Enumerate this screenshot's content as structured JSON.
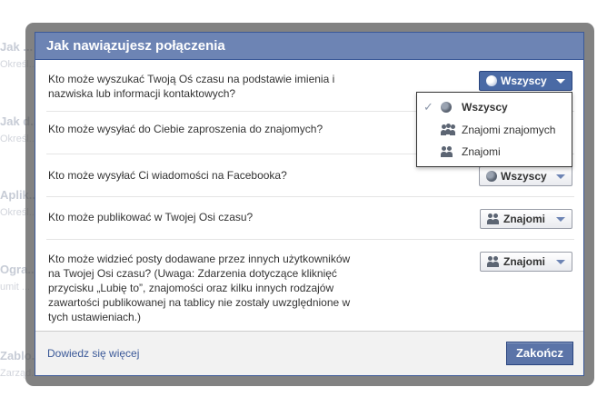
{
  "background": {
    "items": [
      {
        "title": "Jak ...",
        "sub": "Określ..."
      },
      {
        "title": "Jak d...",
        "sub": "Określ..."
      },
      {
        "title": "Aplik...",
        "sub": "Określ..."
      },
      {
        "title": "Ogra...",
        "sub": "umit ..."
      },
      {
        "title": "Zablo...",
        "sub": "Zarząd..."
      }
    ]
  },
  "dialog": {
    "title": "Jak nawiązujesz połączenia",
    "rows": [
      {
        "question": "Kto może wyszukać Twoją Oś czasu na podstawie imienia i\nnazwiska lub informacji kontaktowych?",
        "value": "Wszyscy",
        "icon": "globe-icon",
        "open": true
      },
      {
        "question": "Kto może wysyłać do Ciebie zaproszenia do znajomych?",
        "value": "",
        "icon": "",
        "open": false
      },
      {
        "question": "Kto może wysyłać Ci wiadomości na Facebooka?",
        "value": "Wszyscy",
        "icon": "globe-icon",
        "open": false
      },
      {
        "question": "Kto może publikować w Twojej Osi czasu?",
        "value": "Znajomi",
        "icon": "friends-icon",
        "open": false
      },
      {
        "question": "Kto może widzieć posty dodawane przez innych użytkowników\nna Twojej Osi czasu? (Uwaga: Zdarzenia dotyczące kliknięć\nprzycisku „Lubię to”, znajomości oraz kilku innych rodzajów\nzawartości publikowanej na tablicy nie zostały uwzględnione w\ntych ustawieniach.)",
        "value": "Znajomi",
        "icon": "friends-icon",
        "open": false
      }
    ],
    "menu": {
      "items": [
        {
          "label": "Wszyscy",
          "icon": "globe-icon",
          "selected": true
        },
        {
          "label": "Znajomi znajomych",
          "icon": "friends-of-friends-icon",
          "selected": false
        },
        {
          "label": "Znajomi",
          "icon": "friends-icon",
          "selected": false
        }
      ]
    },
    "footer": {
      "learn_more": "Dowiedz się więcej",
      "done_label": "Zakończ"
    }
  },
  "colors": {
    "header_bg": "#6d84b4",
    "border": "#3b5998",
    "link": "#3b5998",
    "button_bg": "#5b74a8"
  }
}
